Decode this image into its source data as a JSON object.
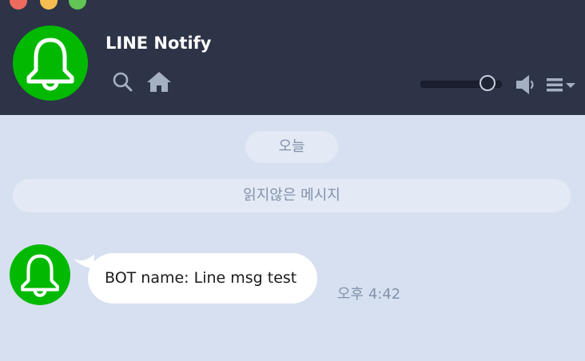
{
  "window": {
    "controls": [
      "close",
      "minimize",
      "zoom"
    ]
  },
  "header": {
    "title": "LINE Notify",
    "avatar_icon": "bell-icon",
    "brand_color": "#00b900",
    "tools": {
      "search_icon": "search-icon",
      "home_icon": "home-icon",
      "speaker_icon": "speaker-icon",
      "menu_icon": "menu-icon"
    },
    "volume_level": 0.9
  },
  "chat": {
    "date_label": "오늘",
    "unread_label": "읽지않은 메시지",
    "messages": [
      {
        "sender_icon": "bell-icon",
        "text": "BOT name: Line msg test",
        "time": "오후 4:42"
      }
    ]
  },
  "colors": {
    "header_bg": "#2d3448",
    "chat_bg": "#d6e0f0",
    "pill_bg": "#e3eaf5",
    "muted_text": "#8391ab"
  }
}
